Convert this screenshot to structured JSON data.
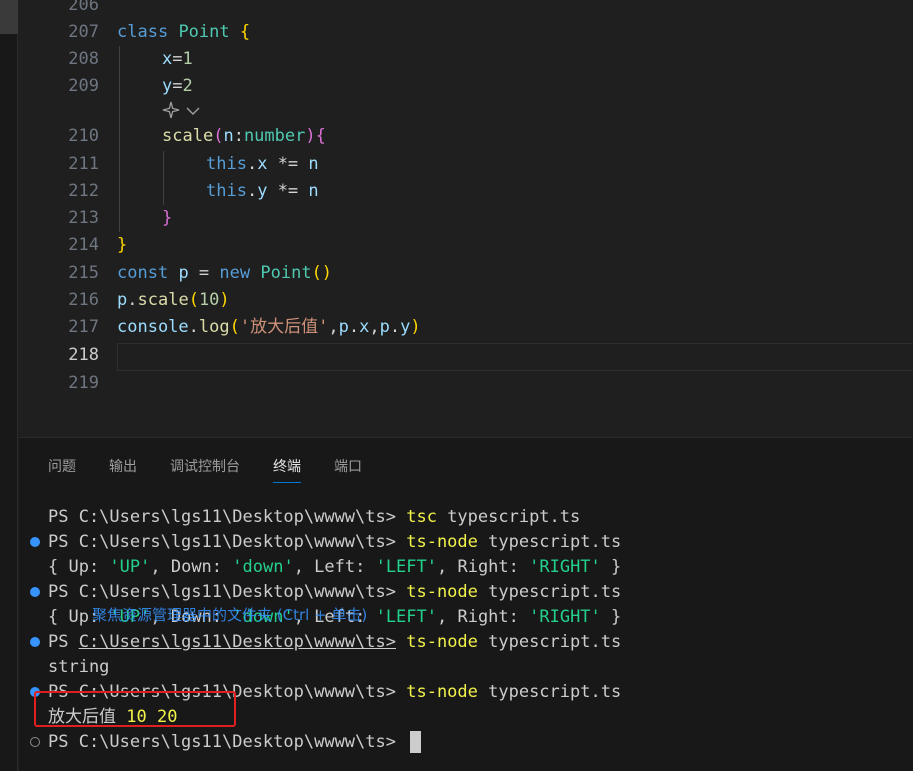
{
  "editor": {
    "line_numbers": [
      "206",
      "207",
      "208",
      "209",
      "210",
      "211",
      "212",
      "213",
      "214",
      "215",
      "216",
      "217",
      "218",
      "219"
    ],
    "codelens_icon": "sparkle-icon",
    "codelens_chevron": "chevron-down-icon",
    "lines": {
      "l207": {
        "kw": "class",
        "name": "Point",
        "brace": "{"
      },
      "l208": {
        "var": "x",
        "eq": "=",
        "val": "1"
      },
      "l209": {
        "var": "y",
        "eq": "=",
        "val": "2"
      },
      "l210": {
        "fn": "scale",
        "p_open": "(",
        "param": "n",
        "colon": ":",
        "type": "number",
        "p_close": ")",
        "brace": "{"
      },
      "l211": {
        "this": "this",
        "dot": ".",
        "prop": "x",
        "op": " *= ",
        "n": "n"
      },
      "l212": {
        "this": "this",
        "dot": ".",
        "prop": "y",
        "op": " *= ",
        "n": "n"
      },
      "l213": {
        "brace": "}"
      },
      "l214": {
        "brace": "}"
      },
      "l215": {
        "kw": "const",
        "var": "p",
        "eq": " = ",
        "kw2": "new",
        "cls": "Point",
        "paren": "()"
      },
      "l216": {
        "obj": "p",
        "dot": ".",
        "fn": "scale",
        "open": "(",
        "num": "10",
        "close": ")"
      },
      "l217": {
        "obj": "console",
        "dot": ".",
        "fn": "log",
        "open": "(",
        "str": "'放大后值'",
        "rest_a": ",",
        "a1": "p",
        "d1": ".",
        "x": "x",
        "comma2": ",",
        "a2": "p",
        "d2": ".",
        "y": "y",
        "close": ")"
      }
    }
  },
  "panel": {
    "tabs": [
      "问题",
      "输出",
      "调试控制台",
      "终端",
      "端口"
    ],
    "active_tab": "终端"
  },
  "terminal": {
    "prompt": "PS C:\\Users\\lgs11\\Desktop\\wwww\\ts> ",
    "prompt_link_part": "C:\\Users\\lgs11\\Desktop\\wwww\\ts>",
    "line1": {
      "cmd": "tsc",
      "arg": " typescript.ts"
    },
    "line2": {
      "cmd": "ts-node",
      "arg": " typescript.ts"
    },
    "line3": {
      "a": "{ Up: ",
      "s1": "'UP'",
      "b": ", Down: ",
      "s2": "'down'",
      "c": ", Left: ",
      "s3": "'LEFT'",
      "d": ", Right: ",
      "s4": "'RIGHT'",
      "e": " }"
    },
    "line4": {
      "cmd": "ts-node",
      "arg": " typescript.ts"
    },
    "line5": {
      "a": "{ Up: ",
      "s1": "'UP'",
      "b": ", Down: ",
      "s2": "'down'",
      "c": ", Left: ",
      "s3": "'LEFT'",
      "d": ", Right: ",
      "s4": "'RIGHT'",
      "e": " }"
    },
    "tooltip": "聚焦资源管理器中的文件夹 (Ctrl + 单击)",
    "line6": {
      "ps": "PS ",
      "cmd": "ts-node",
      "arg": " typescript.ts"
    },
    "line7": "string",
    "line8": {
      "cmd": "ts-node",
      "arg": " typescript.ts"
    },
    "line9": {
      "label": "放大后值 ",
      "n1": "10",
      "sp": " ",
      "n2": "20"
    },
    "colors": {
      "command": "#f1f14c",
      "string": "#23d18b",
      "highlight_box": "#e0201f",
      "status_dot": "#3794ff"
    }
  }
}
